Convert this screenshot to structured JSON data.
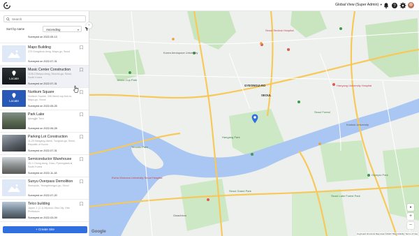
{
  "header": {
    "view_label": "Global View (Super Admin)",
    "view_caret": "▾",
    "icons": [
      "app-logo",
      "bell-icon",
      "help-icon",
      "settings-icon",
      "avatar"
    ]
  },
  "sidebar": {
    "search_placeholder": "Search",
    "sort_label": "Sort by name",
    "sort_value": "Ascending",
    "sort_caret": "▾",
    "create_button": "+ Create Site",
    "first_partial_date": "Surveyed on 2022-05-13",
    "sites": [
      {
        "name": "Mapo Building",
        "address": "270 Gongdeok-dong, Mapo-gu, Seoul",
        "date": "Surveyed on 2022-07-31",
        "thumb": "placeholder"
      },
      {
        "name": "Music Center Construction",
        "address": "1106-3 Banpo-dong, Seocho-gu, Seoul, South Korea",
        "date": "Surveyed on 2022-07-31",
        "thumb": "photo-locate",
        "overlay": "Locate"
      },
      {
        "name": "Nurikum Square",
        "address": "Nurikum Square, 396 World cup buk-ro, Mapo-gu, Seoul",
        "date": "Surveyed on 2022-05-25",
        "thumb": "blue-locate",
        "overlay": "Locate"
      },
      {
        "name": "Park Lake",
        "address": "Ijdongjjin Tovu",
        "date": "Surveyed on 2022-06-28",
        "thumb": "photo"
      },
      {
        "name": "Parking Lot Construction",
        "address": "11-25 Hangang-daero, Yongsan-gu, Seoul, Republic of Korea",
        "date": "Surveyed on 2022-07-31",
        "thumb": "photo"
      },
      {
        "name": "Semiconductor Warehouse",
        "address": "25-1 Chung-dong, Gusu, Pyeongtaek-si, South Korea",
        "date": "Surveyed on 2022-11-18",
        "thumb": "photo"
      },
      {
        "name": "Sunyu Overpass Demolition",
        "address": "Seonyudo, Yeongdeungpo-gu, Seoul",
        "date": "Surveyed on 2022-07-20",
        "thumb": "placeholder"
      },
      {
        "name": "Telco building",
        "address": "Japan, 1 (1-1) Miyoshi, Oita City, Oita Prefecture",
        "date": "Surveyed on 2022-03-09",
        "thumb": "photo"
      }
    ]
  },
  "map": {
    "labels": [
      {
        "text": "Seoul Seobuk Hospital",
        "cls": "red",
        "pos": "l1"
      },
      {
        "text": "Korea Aerospace University",
        "cls": "",
        "pos": "l2"
      },
      {
        "text": "Hanyang University Hospital",
        "cls": "red",
        "pos": "l3"
      },
      {
        "text": "World Cup Park",
        "cls": "green",
        "pos": "l4"
      },
      {
        "text": "GYEONGUI-RO",
        "cls": "bold",
        "pos": "l5"
      },
      {
        "text": "SEOUL",
        "cls": "bold",
        "pos": "l6"
      },
      {
        "text": "Seoul Forest",
        "cls": "green",
        "pos": "l7"
      },
      {
        "text": "Konkuk University",
        "cls": "",
        "pos": "l8"
      },
      {
        "text": "Yeouido Park",
        "cls": "green",
        "pos": "l9"
      },
      {
        "text": "Hangang Park",
        "cls": "green",
        "pos": "l10"
      },
      {
        "text": "Olympic Park",
        "cls": "green",
        "pos": "l11"
      },
      {
        "text": "Ewha Womans University Seoul Hospital",
        "cls": "red",
        "pos": "l12"
      },
      {
        "text": "Seoul Grand Park",
        "cls": "green",
        "pos": "l13"
      },
      {
        "text": "Gwacheon",
        "cls": "",
        "pos": "l14"
      },
      {
        "text": "Seoul Lake Forest Park",
        "cls": "green",
        "pos": "l15"
      }
    ],
    "google": "Google",
    "attribution": "Keyboard shortcuts   Map data ©2022 TMap Mobility   Terms of Use",
    "zoom_in": "+",
    "zoom_out": "−",
    "collapse": "‹"
  }
}
